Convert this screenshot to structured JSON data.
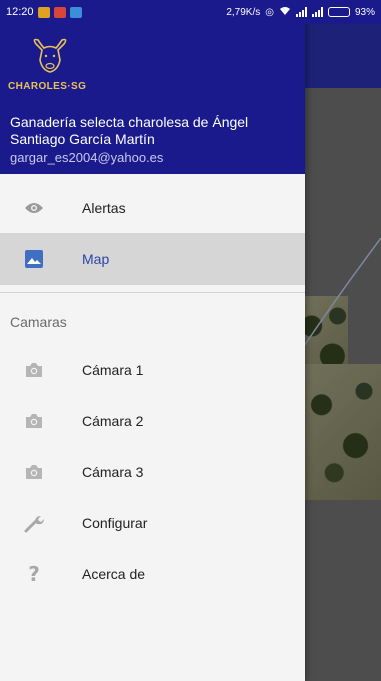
{
  "status_bar": {
    "time": "12:20",
    "speed": "2,79K/s",
    "battery": "93%",
    "battery_level": 0.93
  },
  "drawer": {
    "logo_text": "CHAROLES·SG",
    "ranch_name": "Ganadería selecta charolesa de Ángel Santiago García Martín",
    "email": "gargar_es2004@yahoo.es",
    "menu": [
      {
        "label": "Alertas",
        "icon": "eye-icon",
        "active": false
      },
      {
        "label": "Map",
        "icon": "image-icon",
        "active": true
      }
    ],
    "section_title": "Camaras",
    "cameras": [
      {
        "label": "Cámara 1",
        "icon": "camera-icon"
      },
      {
        "label": "Cámara 2",
        "icon": "camera-icon"
      },
      {
        "label": "Cámara 3",
        "icon": "camera-icon"
      }
    ],
    "settings_label": "Configurar",
    "about_label": "Acerca de"
  },
  "colors": {
    "header": "#1a1a8c",
    "toolbar": "#242a93",
    "active_text": "#2b44a8",
    "drawer_bg": "#f4f4f4",
    "logo_gold": "#e8c25a"
  }
}
